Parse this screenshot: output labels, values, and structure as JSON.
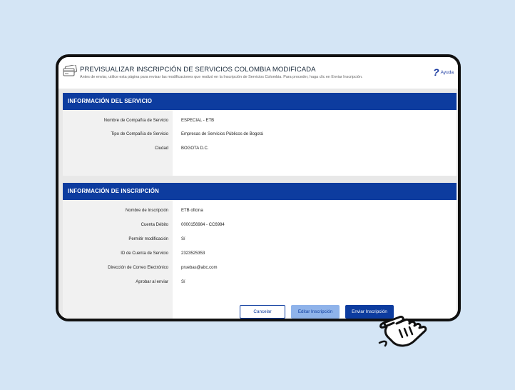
{
  "header": {
    "title": "PREVISUALIZAR INSCRIPCIÓN DE SERVICIOS COLOMBIA MODIFICADA",
    "description": "Antes de enviar, utilice esta página para revisar las modificaciones que realizó en la Inscripción de Servicios Colombia. Para proceder, haga clic en Enviar Inscripción.",
    "help_label": "Ayuda",
    "help_glyph": "?"
  },
  "service_section": {
    "title": "INFORMACIÓN DEL SERVICIO",
    "rows": [
      {
        "label": "Nombre de Compañía de Servicio",
        "value": "ESPECIAL - ETB"
      },
      {
        "label": "Tipo de Compañía de Servicio",
        "value": "Empresas de Servicios Públicos de Bogotá"
      },
      {
        "label": "Ciudad",
        "value": "BOGOTA D.C."
      }
    ]
  },
  "enrollment_section": {
    "title": "INFORMACIÓN DE INSCRIPCIÓN",
    "rows": [
      {
        "label": "Nombre de Inscripción",
        "value": "ETB oficina"
      },
      {
        "label": "Cuenta Débito",
        "value": "0000156984 - CC6984"
      },
      {
        "label": "Permitir modificación",
        "value": "Sí"
      },
      {
        "label": "ID de Cuenta de Servicio",
        "value": "2323525353"
      },
      {
        "label": "Dirección de Correo Electrónico",
        "value": "pruebas@abc.com"
      },
      {
        "label": "Aprobar al enviar",
        "value": "Sí"
      }
    ]
  },
  "buttons": {
    "cancel": "Cancelar",
    "edit": "Editar Inscripción",
    "send": "Enviar Inscripción"
  },
  "colors": {
    "brand_blue": "#0d3c9f",
    "light_blue": "#8fb3ea",
    "background": "#d4e5f5"
  },
  "icons": {
    "header": "credit-card-icon",
    "help": "question-mark-icon",
    "cursor": "pointing-hand-cursor-icon"
  }
}
